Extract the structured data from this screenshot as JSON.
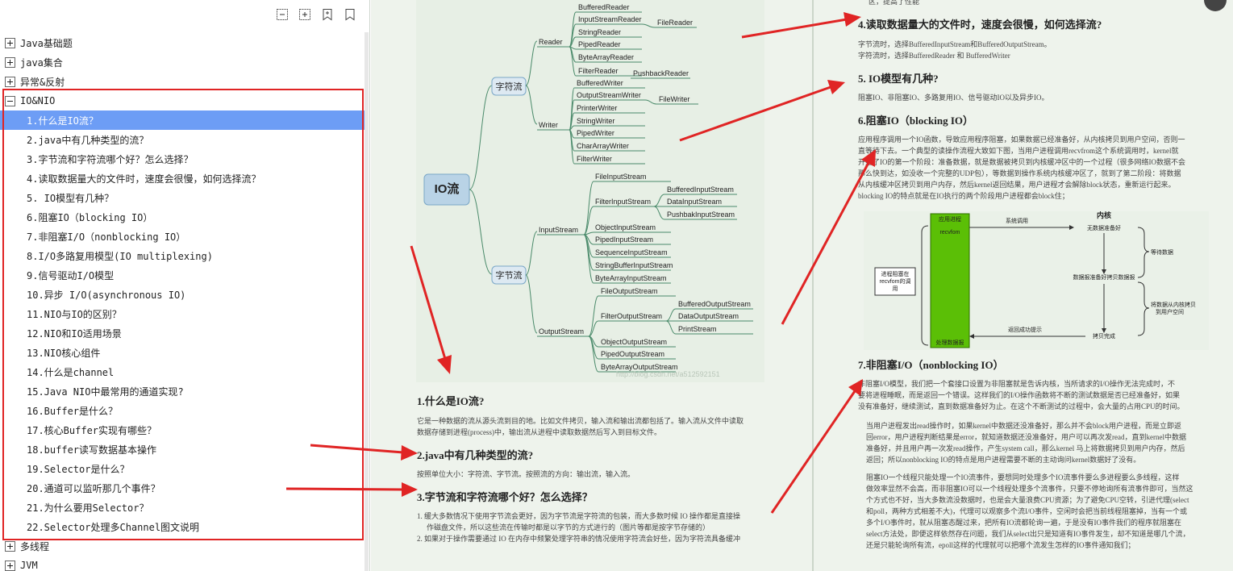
{
  "sidebar": {
    "toolbar": [
      "collapse-all-icon",
      "expand-all-icon",
      "bookmark-add-icon",
      "bookmark-icon"
    ],
    "items": [
      {
        "label": "Java基础题",
        "expanded": false
      },
      {
        "label": "java集合",
        "expanded": false
      },
      {
        "label": "异常&反射",
        "expanded": false
      },
      {
        "label": "IO&NIO",
        "expanded": true,
        "children": [
          "1.什么是IO流？",
          "2.java中有几种类型的流？",
          "3.字节流和字符流哪个好？怎么选择？",
          "4.读取数据量大的文件时，速度会很慢，如何选择流？",
          "5. IO模型有几种？",
          "6.阻塞IO（blocking IO）",
          "7.非阻塞I/O（nonblocking IO）",
          "8.I/O多路复用模型(IO multiplexing)",
          "9.信号驱动I/O模型",
          "10.异步 I/O(asynchronous IO)",
          "11.NIO与IO的区别？",
          "12.NIO和IO适用场景",
          "13.NIO核心组件",
          "14.什么是channel",
          "15.Java NIO中最常用的通道实现?",
          "16.Buffer是什么？",
          "17.核心Buffer实现有哪些？",
          "18.buffer读写数据基本操作",
          "19.Selector是什么？",
          "20.通道可以监听那几个事件？",
          "21.为什么要用Selector？",
          "22.Selector处理多Channel图文说明"
        ]
      },
      {
        "label": "多线程",
        "expanded": false
      },
      {
        "label": "JVM",
        "expanded": false
      }
    ],
    "selected_index": 0,
    "highlight_color": "#6d9df5",
    "box_color": "#e02424"
  },
  "mindmap": {
    "root": "IO流",
    "char_stream": "字符流",
    "byte_stream": "字节流",
    "reader": "Reader",
    "writer": "Writer",
    "input_stream": "InputStream",
    "output_stream": "OutputStream",
    "reader_children": [
      "BufferedReader",
      "InputStreamReader",
      "StringReader",
      "PipedReader",
      "ByteArrayReader",
      "FilterReader"
    ],
    "file_reader": "FileReader",
    "pushback_reader": "PushbackReader",
    "writer_children": [
      "BufferedWriter",
      "OutputStreamWriter",
      "PrinterWriter",
      "StringWriter",
      "PipedWriter",
      "CharArrayWriter",
      "FilterWriter"
    ],
    "file_writer": "FileWriter",
    "input_children": [
      "FileInputStream",
      "FilterInputStream",
      "ObjectInputStream",
      "PipedInputStream",
      "SequenceInputStream",
      "StringBufferInputStream",
      "ByteArrayInputStream"
    ],
    "filter_input_children": [
      "BufferedInputStream",
      "DataInputStream",
      "PushbakInputStream"
    ],
    "output_children": [
      "FileOutputStream",
      "FilterOutputStream",
      "ObjectOutputStream",
      "PipedOutputStream",
      "ByteArrayOutputStream"
    ],
    "filter_output_children": [
      "BufferedOutputStream",
      "DataOutputStream",
      "PrintStream"
    ],
    "watermark": "http://blog.csdn.net/a512592151"
  },
  "left_page": {
    "q1_title": "1.什么是IO流?",
    "q1_body_1": "它是一种数据的流从源头流到目的地。比如文件拷贝，输入流和输出流都包括了。输入流从文件中读取",
    "q1_body_2": "数据存储到进程(process)中，输出流从进程中读取数据然后写入到目标文件。",
    "q2_title": "2.java中有几种类型的流?",
    "q2_body": "按照单位大小：字符流、字节流。按照流的方向：输出流，输入流。",
    "q3_title": "3.字节流和字符流哪个好？怎么选择？",
    "q3_item1_a": "1. 缓大多数情况下使用字节流会更好，因为字节流是字符流的包装，而大多数时候 IO 操作都是直接操",
    "q3_item1_b": "作磁盘文件，所以这些流在传输时都是以字节的方式进行的（图片等都是按字节存储的）",
    "q3_item2": "2. 如果对于操作需要通过 IO 在内存中频繁处理字符串的情况使用字符流会好些，因为字符流具备缓冲"
  },
  "right_page": {
    "top_fragment": "区，提高了性能",
    "q4_title": "4.读取数据量大的文件时，速度会很慢，如何选择流?",
    "q4_body_1": "字节流时，选择BufferedInputStream和BufferedOutputStream。",
    "q4_body_2": "字符流时，选择BufferedReader 和 BufferedWriter",
    "q5_title": "5. IO模型有几种?",
    "q5_body": "阻塞IO、非阻塞IO、多路复用IO、信号驱动IO以及异步IO。",
    "q6_title": "6.阻塞IO（blocking IO）",
    "q6_lines": [
      " 应用程序调用一个IO函数，导致应用程序阻塞，如果数据已经准备好，从内核拷贝到用户空间，否则一",
      "直等待下去。一个典型的读操作流程大致如下图，当用户进程调用recvfrom这个系统调用时，kernel就",
      "开始了IO的第一个阶段：准备数据，就是数据被拷贝到内核缓冲区中的一个过程（很多网络IO数据不会",
      "那么快到达，如没收一个完整的UDP包），等数据到操作系统内核缓冲区了，就到了第二阶段：将数据",
      "从内核缓冲区拷贝到用户内存，然后kernel返回结果，用户进程才会解除block状态，重新运行起来。",
      "blocking IO的特点就是在IO执行的两个阶段用户进程都会block住；"
    ],
    "diagram": {
      "app_process": "应用进程",
      "recvfrom": "recvfom",
      "syscall": "系统调用",
      "kernel": "内核",
      "no_data": "无数据准备好",
      "wait_data": "等待数据",
      "data_ready": "数据报准备好拷贝数据报",
      "copy_data": "将数据从内核拷贝到用户空间",
      "copy_done": "拷贝完成",
      "return_ok": "返回成功提示",
      "process_data": "处理数据报",
      "blocked": "进程阻塞在recvfom的调用"
    },
    "q7_title": "7.非阻塞I/O（nonblocking IO）",
    "q7_para1": [
      "非阻塞I/O模型，我们把一个套接口设置为非阻塞就是告诉内核，当所请求的I/O操作无法完成时，不",
      "要将进程睡眠，而是返回一个错误。这样我们的I/O操作函数将不断的测试数据是否已经准备好，如果",
      "没有准备好，继续测试，直到数据准备好为止。在这个不断测试的过程中，会大量的占用CPU的时间。"
    ],
    "q7_para2": [
      "当用户进程发出read操作时，如果kernel中数据还没准备好，那么并不会block用户进程，而是立即返",
      "回error，用户进程判断结果是error，就知道数据还没准备好，用户可以再次发read，直到kernel中数据",
      "准备好，并且用户再一次发read操作，产生system call，那么kernel 马上将数据拷贝到用户内存，然后",
      "返回；所以nonblocking IO的特点是用户进程需要不断的主动询问kernel数据好了没有。"
    ],
    "q7_para3": [
      "阻塞IO一个线程只能处理一个IO流事件，要想同时处理多个IO流事件要么多进程要么多线程，这样",
      "做效率显然不会高，而非阻塞IO可以一个线程处理多个流事件，只要不停地询所有流事件即可，当然这",
      "个方式也不好，当大多数流没数据时，也是会大量浪费CPU资源；为了避免CPU空转，引进代理(select",
      "和poll，两种方式相差不大)，代理可以观察多个流I/O事件，空闲时会把当前线程阻塞掉，当有一个或",
      "多个I/O事件时，就从阻塞态醒过来，把所有IO流都轮询一遍，于是没有IO事件我们的程序就阻塞在",
      "select方法处，即便这样依然存在问题，我们从select出只是知道有IO事件发生，却不知道是哪几个流，",
      "还是只能轮询所有流，epoll这样的代理就可以把哪个流发生怎样的IO事件通知我们；"
    ]
  },
  "colors": {
    "page_bg": "#eef3ec",
    "annotation_arrow": "#e02424",
    "diagram_block": "#5bbf06"
  }
}
